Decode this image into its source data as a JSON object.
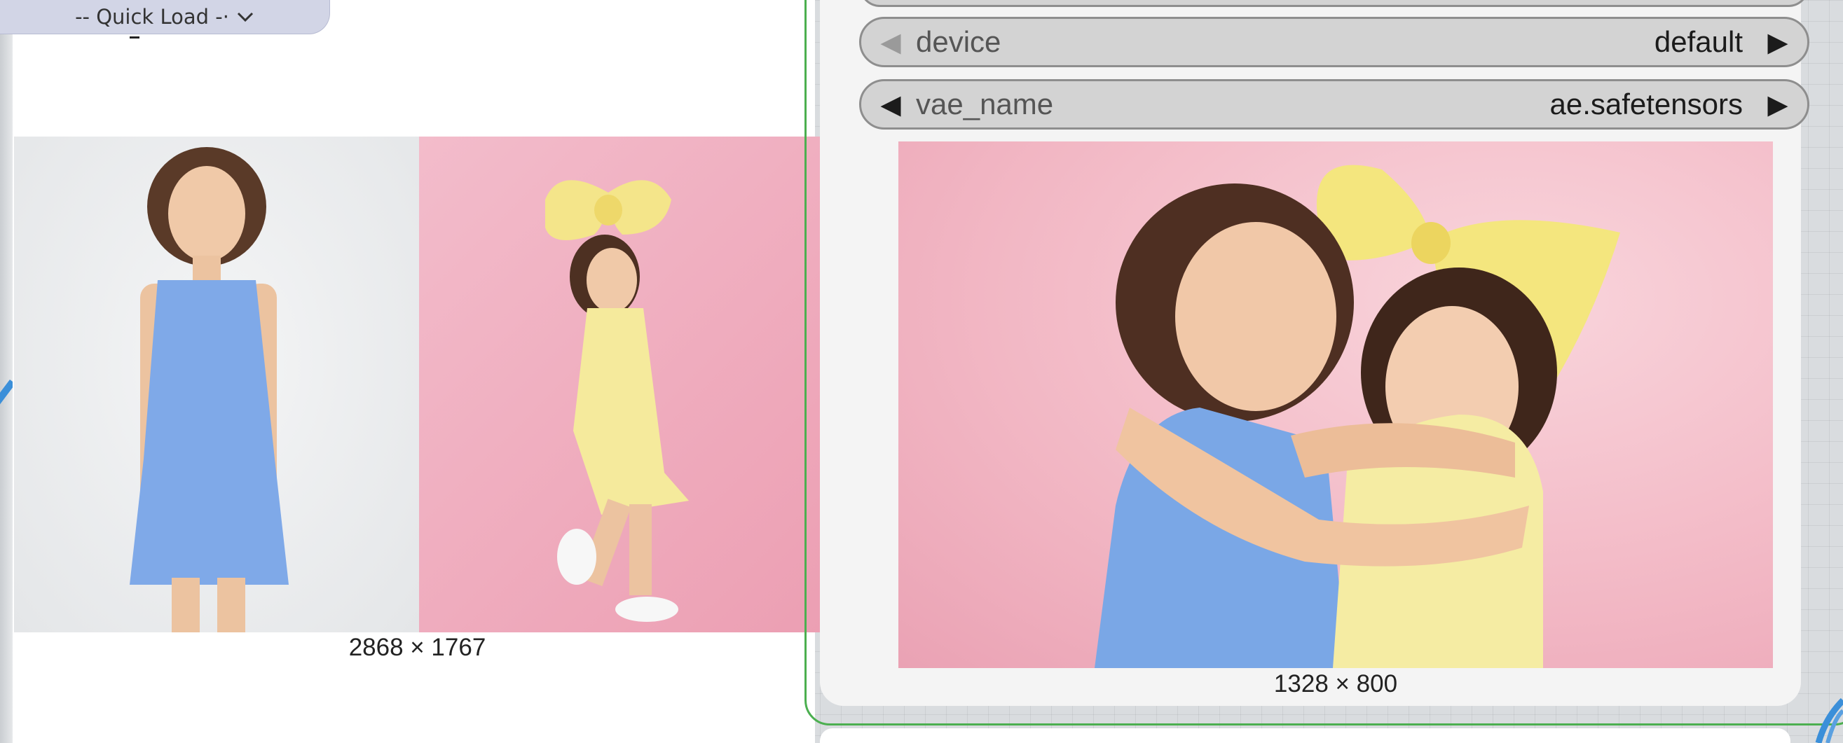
{
  "quick_load": {
    "label": "-- Quick Load -·",
    "icon": "chevron-down-icon"
  },
  "left_node": {
    "images_size_label": "2868 × 1767"
  },
  "right_node": {
    "widgets": [
      {
        "name": "device",
        "value": "default"
      },
      {
        "name": "vae_name",
        "value": "ae.safetensors"
      }
    ],
    "output_size_label": "1328 × 800"
  },
  "colors": {
    "selected_border": "#4caf50",
    "widget_bg": "#d3d3d3",
    "node_bg": "#ffffff"
  }
}
